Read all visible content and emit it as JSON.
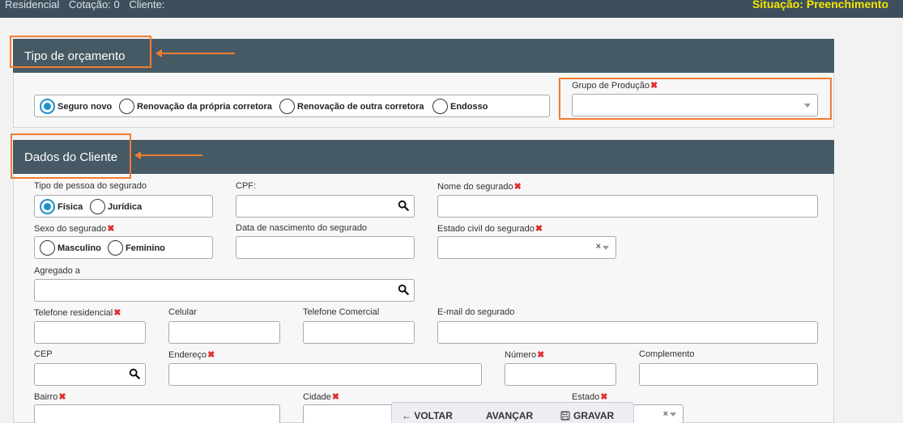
{
  "topbar": {
    "product": "Residencial",
    "quote": "Cotação: 0",
    "client": "Cliente:",
    "status": "Situação: Preenchimento",
    "status_color": "#f5e600"
  },
  "section_budget": {
    "title": "Tipo de orçamento",
    "options": [
      "Seguro novo",
      "Renovação da própria corretora",
      "Renovação de outra corretora",
      "Endosso"
    ],
    "selected": "Seguro novo",
    "group_label": "Grupo de Produção",
    "group_value": ""
  },
  "section_client": {
    "title": "Dados do Cliente",
    "person_type_label": "Tipo de pessoa do segurado",
    "person_types": [
      "Física",
      "Jurídica"
    ],
    "person_type_selected": "Física",
    "cpf_label": "CPF:",
    "name_label": "Nome do segurado",
    "sex_label": "Sexo do segurado",
    "sex_options": [
      "Masculino",
      "Feminino"
    ],
    "birth_label": "Data de nascimento do segurado",
    "marital_label": "Estado civil do segurado",
    "clear_symbol": "×",
    "aggregated_label": "Agregado a",
    "phone_res_label": "Telefone residencial",
    "mobile_label": "Celular",
    "phone_com_label": "Telefone Comercial",
    "email_label": "E-mail do segurado",
    "cep_label": "CEP",
    "address_label": "Endereço",
    "number_label": "Número",
    "complement_label": "Complemento",
    "district_label": "Bairro",
    "city_label": "Cidade",
    "state_label": "Estado"
  },
  "required_mark": "✖",
  "actions": {
    "back": "← VOLTAR",
    "next": "AVANÇAR",
    "save": "GRAVAR"
  },
  "colors": {
    "header_bg": "#455a64",
    "accent": "#1e90c8",
    "callout": "#f07c33",
    "required": "#e02b2b"
  }
}
